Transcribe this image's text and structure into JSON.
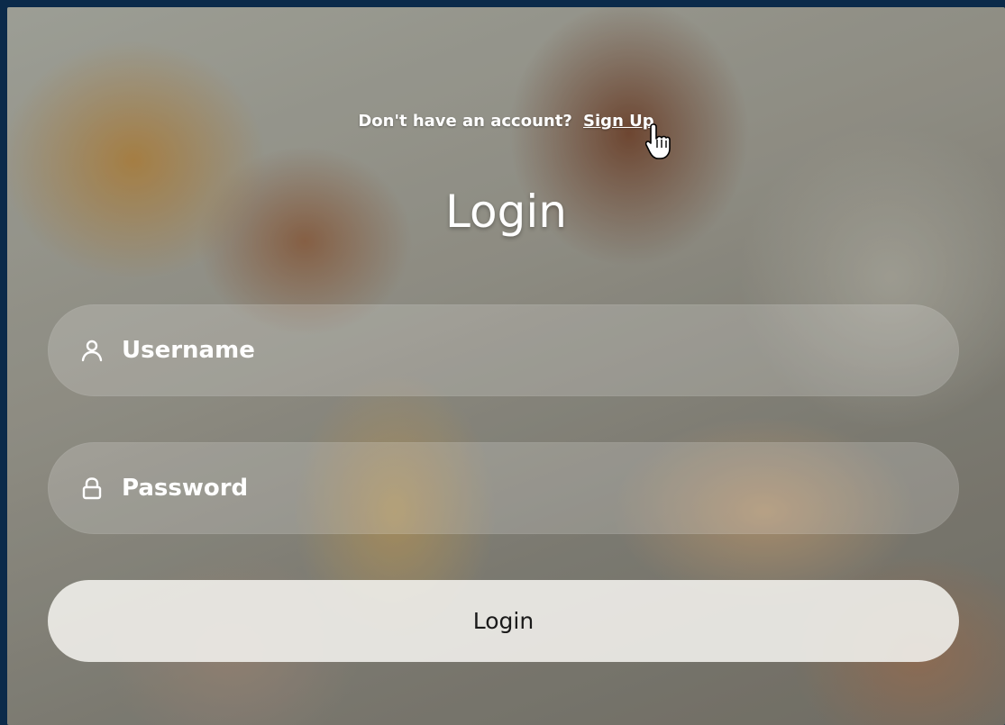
{
  "prompt": {
    "text": "Don't have an account?",
    "link_label": "Sign Up"
  },
  "title": "Login",
  "form": {
    "username_placeholder": "Username",
    "password_placeholder": "Password",
    "username_icon": "user-icon",
    "password_icon": "lock-icon",
    "submit_label": "Login"
  },
  "colors": {
    "page_border": "#0b2a4a",
    "text": "#ffffff",
    "button_text": "#1a1a1a"
  }
}
